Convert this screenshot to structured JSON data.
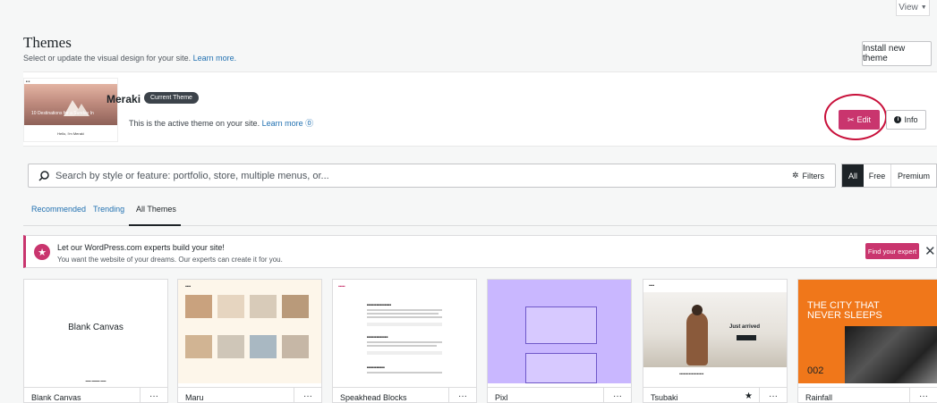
{
  "top": {
    "view_label": "View",
    "view_arrow": "▼"
  },
  "header": {
    "title": "Themes",
    "subtitle": "Select or update the visual design for your site.",
    "learn_more": "Learn more.",
    "install_button": "Install new theme"
  },
  "current_theme": {
    "name": "Meraki",
    "badge": "Current Theme",
    "description": "This is the active theme on your site.",
    "learn_more": "Learn more",
    "edit_button": "Edit",
    "info_button": "Info",
    "thumb_caption": "10 Destinations for a Sunday In",
    "thumb_hello": "Hello, I'm Meraki",
    "edit_highlight_color": "#c8103a"
  },
  "search": {
    "placeholder": "Search by style or feature: portfolio, store, multiple menus, or...",
    "filters_label": "Filters",
    "segments": [
      "All",
      "Free",
      "Premium"
    ]
  },
  "tabs": [
    "Recommended",
    "Trending",
    "All Themes"
  ],
  "banner": {
    "title": "Let our WordPress.com experts build your site!",
    "subtitle": "You want the website of your dreams. Our experts can create it for you.",
    "button": "Find your expert",
    "close": "✕"
  },
  "themes": [
    {
      "name": "Blank Canvas",
      "preview_label": "Blank Canvas"
    },
    {
      "name": "Maru"
    },
    {
      "name": "Speakhead Blocks"
    },
    {
      "name": "Pixl"
    },
    {
      "name": "Tsubaki",
      "preview_label": "Just arrived"
    },
    {
      "name": "Rainfall",
      "preview_label": "THE CITY THAT NEVER SLEEPS",
      "preview_number": "002"
    }
  ],
  "more_glyph": "···",
  "colors": {
    "accent": "#c9356e",
    "link": "#2271b1",
    "dark": "#1d2327"
  }
}
